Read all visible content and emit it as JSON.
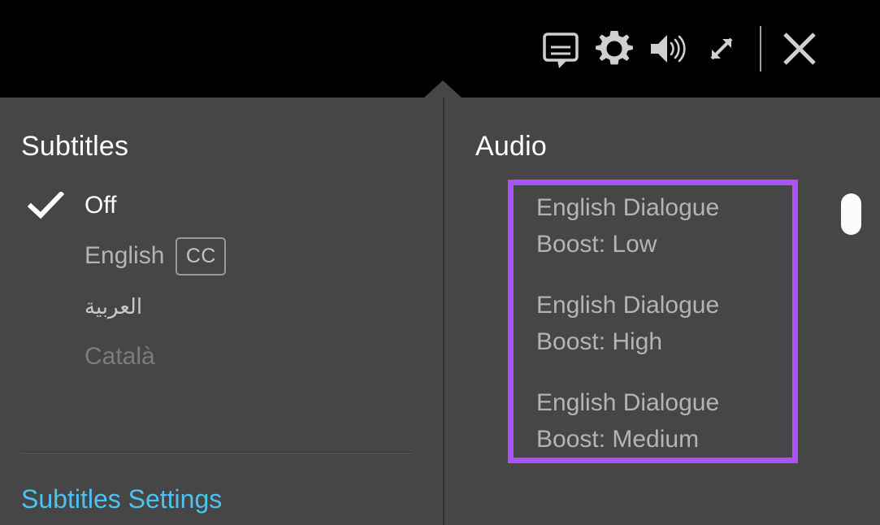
{
  "toolbar": {
    "buttons": [
      {
        "name": "subtitles-icon",
        "label": "Subtitles",
        "active": true
      },
      {
        "name": "settings-gear-icon",
        "label": "Settings",
        "active": false
      },
      {
        "name": "volume-icon",
        "label": "Volume",
        "active": false
      },
      {
        "name": "fullscreen-expand-icon",
        "label": "Fullscreen",
        "active": false
      },
      {
        "name": "close-icon",
        "label": "Close",
        "active": false
      }
    ],
    "icon_color": "#cfcfcf",
    "separator_color": "#9a9a9a"
  },
  "panel": {
    "background": "#464646",
    "subtitles": {
      "title": "Subtitles",
      "options": [
        {
          "label": "Off",
          "selected": true,
          "badge": "",
          "rtl": false,
          "dim": false
        },
        {
          "label": "English",
          "selected": false,
          "badge": "CC",
          "rtl": false,
          "dim": false
        },
        {
          "label": "العربية",
          "selected": false,
          "badge": "",
          "rtl": true,
          "dim": false
        },
        {
          "label": "Català",
          "selected": false,
          "badge": "",
          "rtl": false,
          "dim": true
        }
      ],
      "settings_link": "Subtitles Settings",
      "settings_link_color": "#4cc2f1"
    },
    "audio": {
      "title": "Audio",
      "options": [
        "English Dialogue Boost: Low",
        "English Dialogue Boost: High",
        "English Dialogue Boost: Medium"
      ],
      "highlight_color": "#a855f7"
    }
  },
  "scrollbar": {
    "thumb_color": "#fbfbfb"
  }
}
